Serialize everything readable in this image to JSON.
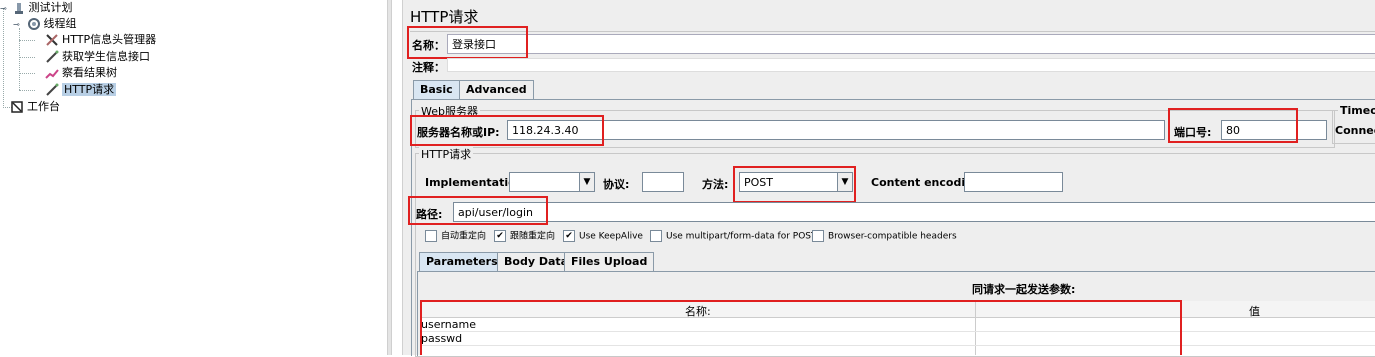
{
  "tree": {
    "items": [
      {
        "label": "测试计划",
        "icon": "test-plan-icon"
      },
      {
        "label": "线程组",
        "icon": "thread-group-icon"
      },
      {
        "label": "HTTP信息头管理器",
        "icon": "header-manager-icon"
      },
      {
        "label": "获取学生信息接口",
        "icon": "sampler-icon"
      },
      {
        "label": "察看结果树",
        "icon": "results-tree-icon"
      },
      {
        "label": "HTTP请求",
        "icon": "sampler-icon"
      },
      {
        "label": "工作台",
        "icon": "workbench-icon"
      }
    ]
  },
  "panel": {
    "title": "HTTP请求",
    "name_label": "名称：",
    "name_value": "登录接口",
    "comment_label": "注释：",
    "tabs": [
      "Basic",
      "Advanced"
    ],
    "web_server": {
      "group_label": "Web服务器",
      "server_label": "服务器名称或IP:",
      "server_value": "118.24.3.40",
      "port_label": "端口号:",
      "port_value": "80",
      "timeout_label": "Timeout",
      "connect_label": "Connect"
    },
    "http_request": {
      "group_label": "HTTP请求",
      "implementation_label": "Implementation:",
      "implementation_value": "",
      "protocol_label": "协议:",
      "protocol_value": "",
      "method_label": "方法:",
      "method_value": "POST",
      "encoding_label": "Content encoding:",
      "encoding_value": "",
      "path_label": "路径:",
      "path_value": "api/user/login"
    },
    "checkboxes": [
      {
        "label": "自动重定向",
        "checked": false
      },
      {
        "label": "跟随重定向",
        "checked": true
      },
      {
        "label": "Use KeepAlive",
        "checked": true
      },
      {
        "label": "Use multipart/form-data for POST",
        "checked": false
      },
      {
        "label": "Browser-compatible headers",
        "checked": false
      }
    ],
    "param_tabs": [
      "Parameters",
      "Body Data",
      "Files Upload"
    ],
    "params": {
      "caption": "同请求一起发送参数:",
      "columns": [
        "名称:",
        "值"
      ],
      "rows": [
        {
          "name": "username",
          "value": ""
        },
        {
          "name": "passwd",
          "value": ""
        }
      ]
    }
  }
}
